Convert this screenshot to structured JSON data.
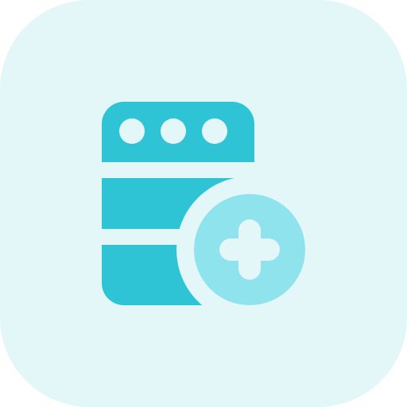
{
  "icon": {
    "name": "add-server-icon",
    "colors": {
      "tile_background": "#E3F7F9",
      "server_body": "#2EC4D6",
      "server_dots": "#E3F7F9",
      "badge_ring": "#E3F7F9",
      "badge_fill": "#8FE3EC",
      "plus": "#E3F7F9"
    }
  }
}
